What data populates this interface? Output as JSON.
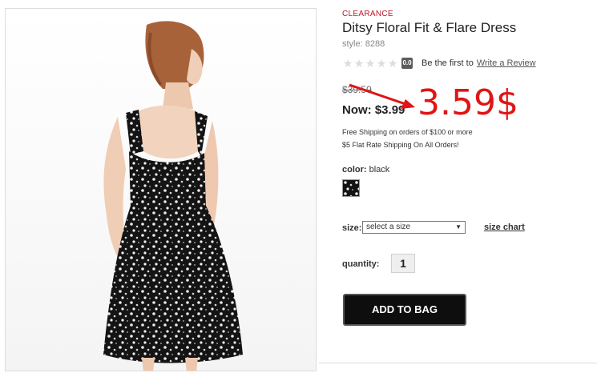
{
  "product": {
    "badge": "CLEARANCE",
    "title": "Ditsy Floral Fit & Flare Dress",
    "style": "style: 8288",
    "image": "dress-back-photo"
  },
  "rating": {
    "stars": 0,
    "max_stars": 5,
    "score": "0.0",
    "prompt": "Be the first to",
    "review_link": "Write a Review"
  },
  "pricing": {
    "original": "$39.50",
    "now_prefix": "Now:",
    "now_value": "$3.99",
    "annotation": "3.59$",
    "annotation_color": "#e11414"
  },
  "shipping": {
    "line1": "Free Shipping on orders of $100 or more",
    "line2": "$5 Flat Rate Shipping On All Orders!"
  },
  "color": {
    "label": "color:",
    "value": "black"
  },
  "size": {
    "label": "size:",
    "selected": "select a size",
    "chart_link": "size chart"
  },
  "quantity": {
    "label": "quantity:",
    "value": "1"
  },
  "actions": {
    "add_to_bag": "ADD TO BAG"
  }
}
